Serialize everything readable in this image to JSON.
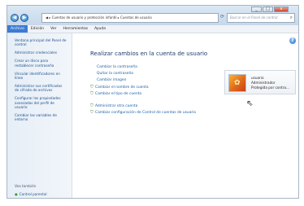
{
  "window": {
    "controls": {
      "minimize": "_",
      "maximize": "□",
      "close": "x"
    }
  },
  "nav": {
    "back": "◀",
    "forward": "▶"
  },
  "address": {
    "text": "◀ ▸ Cuentas de usuario y protección infantil ▸ Cuentas de usuario",
    "search_placeholder": "Buscar en el Panel de control"
  },
  "menu": {
    "items": [
      {
        "label": "Archivo",
        "selected": true
      },
      {
        "label": "Edición",
        "selected": false
      },
      {
        "label": "Ver",
        "selected": false
      },
      {
        "label": "Herramientas",
        "selected": false
      },
      {
        "label": "Ayuda",
        "selected": false
      }
    ]
  },
  "sidebar": {
    "items": [
      "Ventana principal del Panel de control",
      "Administrar credenciales",
      "Crear un disco para restablecer contraseña",
      "Vincular identificadores en línea",
      "Administrar sus certificados de cifrado de archivos",
      "Configurar las propiedades avanzadas del perfil de usuario",
      "Cambiar las variables de entorno"
    ],
    "see_also": "Vea también",
    "parental_control": "Control parental"
  },
  "main": {
    "heading": "Realizar cambios en la cuenta de usuario",
    "links": [
      "Cambiar la contraseña",
      "Quitar la contraseña",
      "Cambiar imagen"
    ],
    "shield_links": [
      "Cambiar el nombre de cuenta",
      "Cambiar el tipo de cuenta"
    ],
    "admin_links": [
      "Administrar otra cuenta",
      "Cambiar configuración de Control de cuentas de usuario"
    ]
  },
  "account": {
    "name": "usuario",
    "role": "Administrador",
    "status": "Protegida por contra..."
  },
  "colors": {
    "link": "#1d5fa8",
    "heading": "#1e3f6e",
    "accent": "#3a7bd5"
  }
}
